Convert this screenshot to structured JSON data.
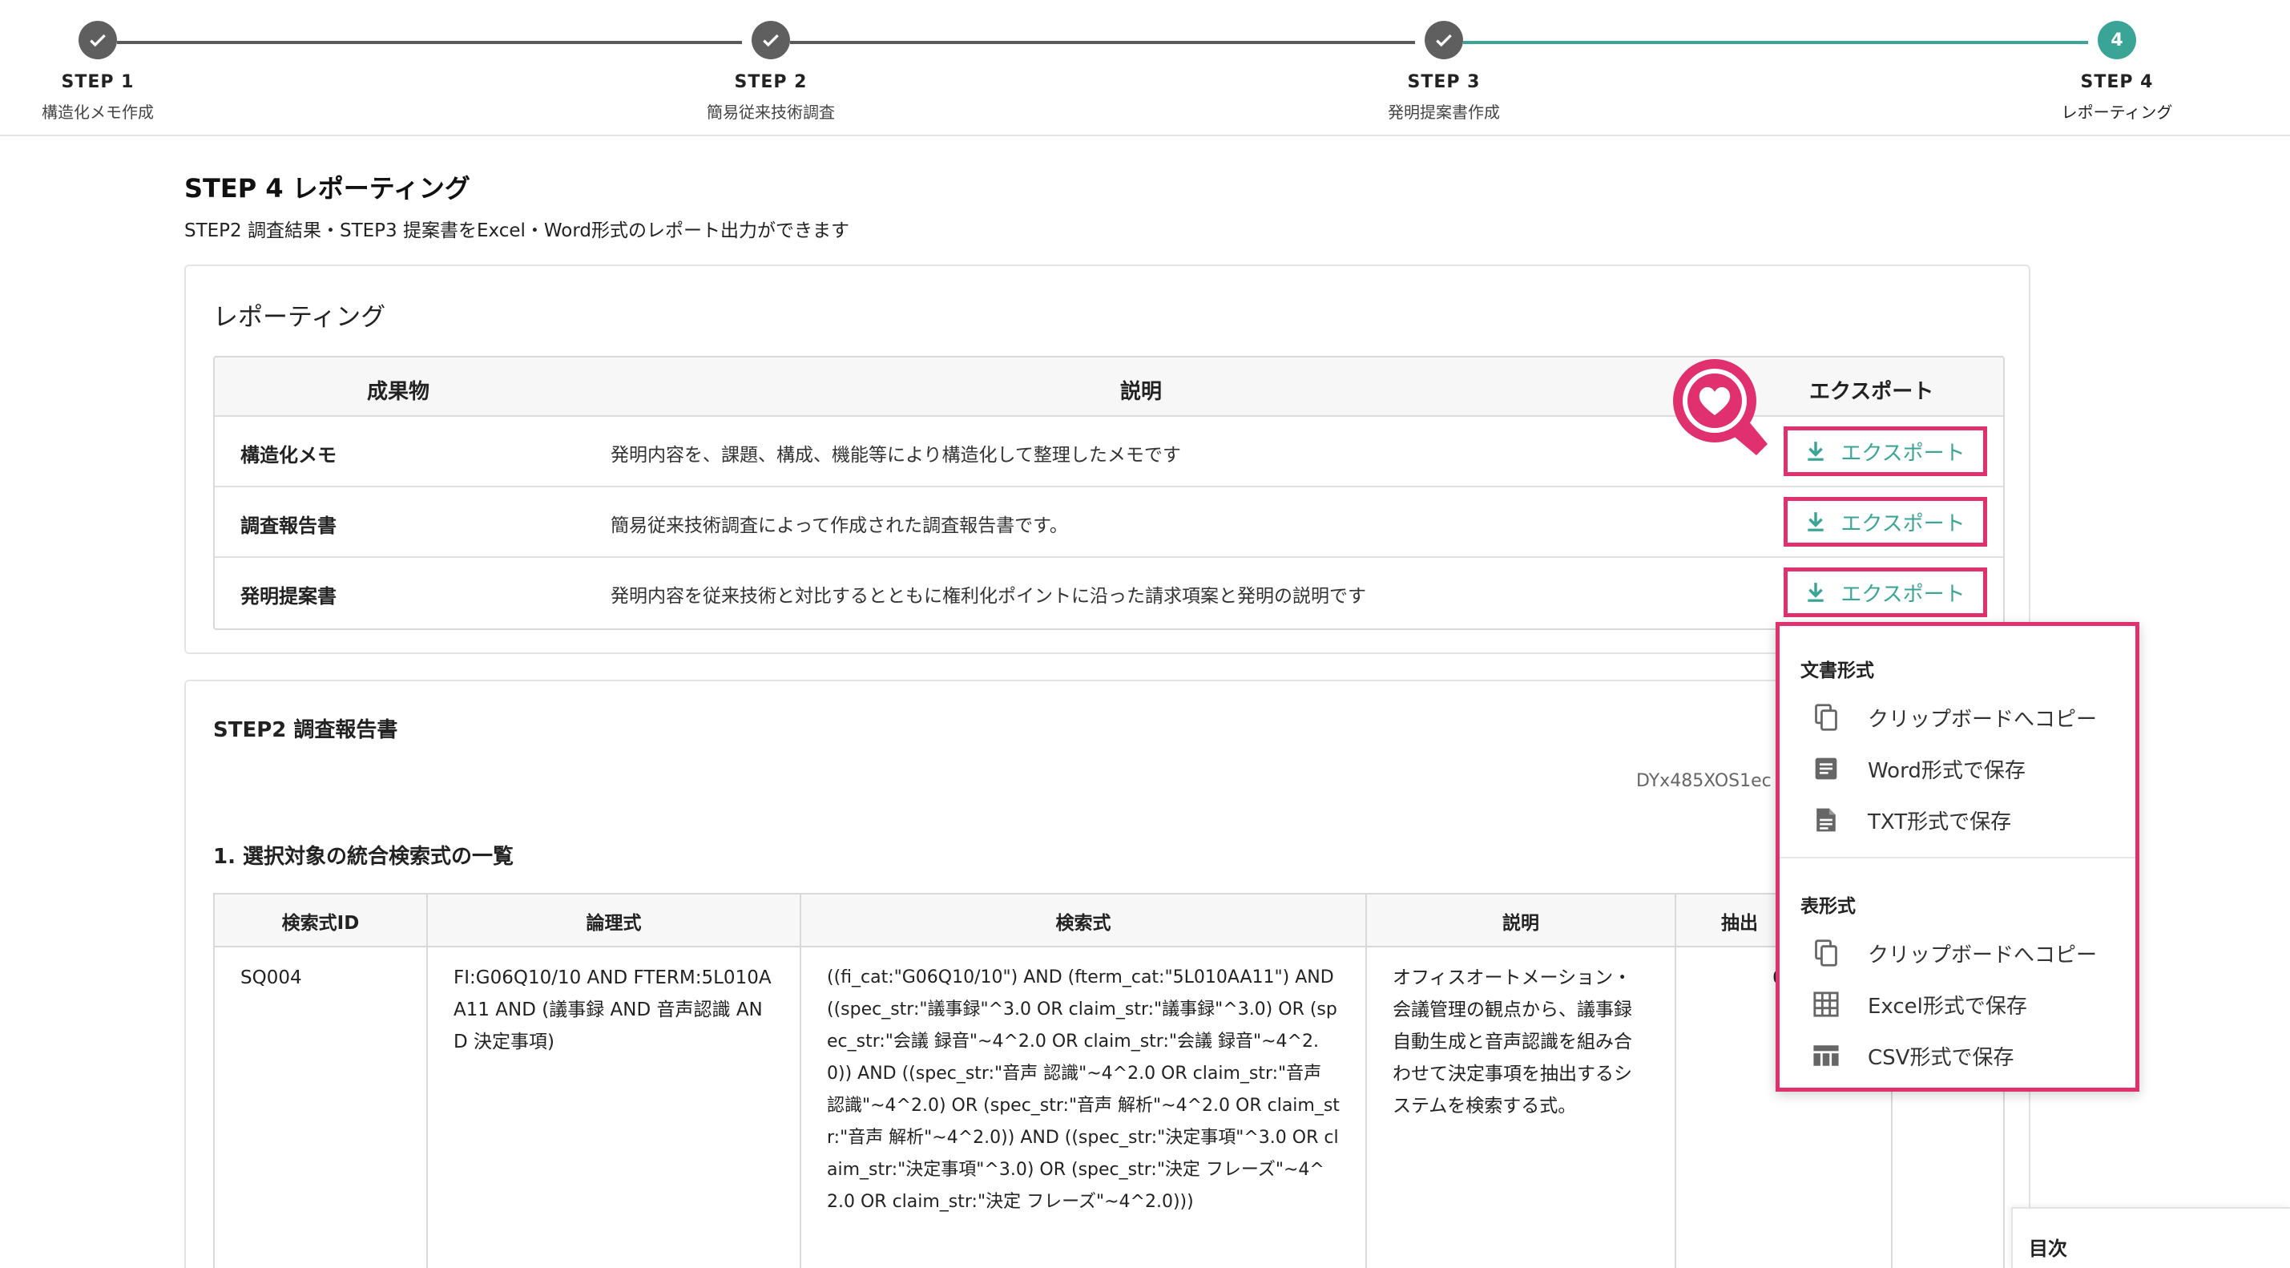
{
  "stepper": {
    "steps": [
      {
        "title": "STEP 1",
        "sub": "構造化メモ作成",
        "state": "done"
      },
      {
        "title": "STEP 2",
        "sub": "簡易従来技術調査",
        "state": "done"
      },
      {
        "title": "STEP 3",
        "sub": "発明提案書作成",
        "state": "done"
      },
      {
        "title": "STEP 4",
        "sub": "レポーティング",
        "state": "current",
        "number": "4"
      }
    ]
  },
  "page": {
    "title": "STEP 4 レポーティング",
    "description": "STEP2 調査結果・STEP3 提案書をExcel・Word形式のレポート出力ができます"
  },
  "reporting": {
    "title": "レポーティング",
    "headers": {
      "deliverable": "成果物",
      "description": "説明",
      "export": "エクスポート"
    },
    "rows": [
      {
        "name": "構造化メモ",
        "desc": "発明内容を、課題、構成、機能等により構造化して整理したメモです",
        "button": "エクスポート"
      },
      {
        "name": "調査報告書",
        "desc": "簡易従来技術調査によって作成された調査報告書です。",
        "button": "エクスポート"
      },
      {
        "name": "発明提案書",
        "desc": "発明内容を従来技術と対比するとともに権利化ポイントに沿った請求項案と発明の説明です",
        "button": "エクスポート"
      }
    ]
  },
  "step2": {
    "title": "STEP2 調査報告書",
    "doc_id": "DYx485XOS1ec",
    "subheading": "1. 選択対象の統合検索式の一覧",
    "headers": {
      "id": "検索式ID",
      "logic": "論理式",
      "query": "検索式",
      "desc": "説明",
      "extract": "抽出"
    },
    "row": {
      "id": "SQ004",
      "logic": "FI:G06Q10/10 AND FTERM:5L010AA11 AND (議事録 AND 音声認識 AND 決定事項)",
      "query": "((fi_cat:\"G06Q10/10\") AND (fterm_cat:\"5L010AA11\") AND ((spec_str:\"議事録\"^3.0 OR claim_str:\"議事録\"^3.0) OR (spec_str:\"会議 録音\"~4^2.0 OR claim_str:\"会議 録音\"~4^2.0)) AND ((spec_str:\"音声 認識\"~4^2.0 OR claim_str:\"音声 認識\"~4^2.0) OR (spec_str:\"音声 解析\"~4^2.0 OR claim_str:\"音声 解析\"~4^2.0)) AND ((spec_str:\"決定事項\"^3.0 OR claim_str:\"決定事項\"^3.0) OR (spec_str:\"決定 フレーズ\"~4^2.0 OR claim_str:\"決定 フレーズ\"~4^2.0)))",
      "desc": "オフィスオートメーション・会議管理の観点から、議事録自動生成と音声認識を組み合わせて決定事項を抽出するシステムを検索する式。",
      "extract": "6"
    }
  },
  "export_menu": {
    "groups": [
      {
        "title": "文書形式",
        "items": [
          {
            "label": "クリップボードへコピー",
            "icon": "copy-icon"
          },
          {
            "label": "Word形式で保存",
            "icon": "document-icon"
          },
          {
            "label": "TXT形式で保存",
            "icon": "text-file-icon"
          }
        ]
      },
      {
        "title": "表形式",
        "items": [
          {
            "label": "クリップボードへコピー",
            "icon": "copy-icon"
          },
          {
            "label": "Excel形式で保存",
            "icon": "grid-icon"
          },
          {
            "label": "CSV形式で保存",
            "icon": "table-icon"
          }
        ]
      }
    ]
  },
  "toc": {
    "label": "目次"
  },
  "colors": {
    "accent": "#3aa597",
    "highlight": "#e0306d",
    "step_done": "#5f5f5f"
  }
}
